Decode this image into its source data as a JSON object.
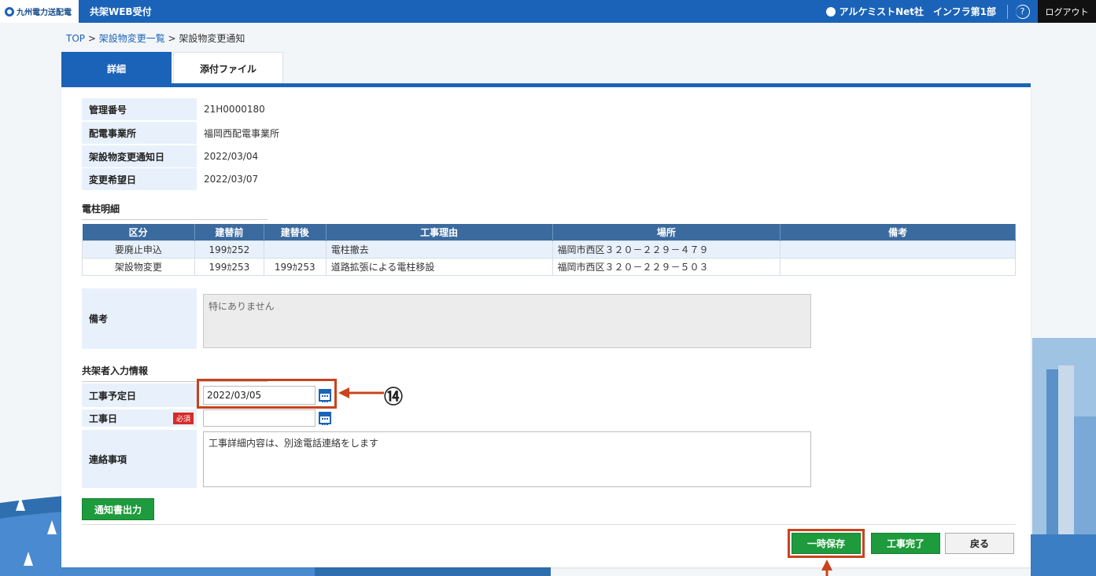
{
  "header": {
    "logo_text": "九州電力送配電",
    "app_title": "共架WEB受付",
    "user": "アルケミストNet社　インフラ第1部",
    "help_symbol": "?",
    "logout_label": "ログアウト",
    "color_bar": "#1b63b8"
  },
  "breadcrumb": {
    "top": "TOP",
    "sep": " > ",
    "list": "架設物変更一覧",
    "current": "架設物変更通知"
  },
  "tabs": [
    {
      "label": "詳細",
      "active": true
    },
    {
      "label": "添付ファイル",
      "active": false
    }
  ],
  "info": [
    {
      "label": "管理番号",
      "value": "21H0000180"
    },
    {
      "label": "配電事業所",
      "value": "福岡西配電事業所"
    },
    {
      "label": "架設物変更通知日",
      "value": "2022/03/04"
    },
    {
      "label": "変更希望日",
      "value": "2022/03/07"
    }
  ],
  "pole_section_title": "電柱明細",
  "pole_table": {
    "headers": [
      "区分",
      "建替前",
      "建替後",
      "工事理由",
      "場所",
      "備考"
    ],
    "rows": [
      [
        "要廃止申込",
        "199ｶ252",
        "",
        "電柱撤去",
        "福岡市西区３２０－２２９－４７９",
        ""
      ],
      [
        "架設物変更",
        "199ｶ253",
        "199ｶ253",
        "道路拡張による電柱移設",
        "福岡市西区３２０－２２９－５０３",
        ""
      ]
    ]
  },
  "remarks": {
    "label": "備考",
    "value": "特にありません"
  },
  "co_section_title": "共架者入力情報",
  "form": {
    "planned_date_label": "工事予定日",
    "planned_date_value": "2022/03/05",
    "work_date_label": "工事日",
    "required_badge": "必須",
    "work_date_value": "",
    "contact_label": "連絡事項",
    "contact_value": "工事詳細内容は、別途電話連絡をします"
  },
  "buttons": {
    "notice_output": "通知書出力",
    "temp_save": "一時保存",
    "complete": "工事完了",
    "back": "戻る"
  },
  "annotation": {
    "callout_number": "⑭",
    "highlight_color": "#c9431c"
  }
}
